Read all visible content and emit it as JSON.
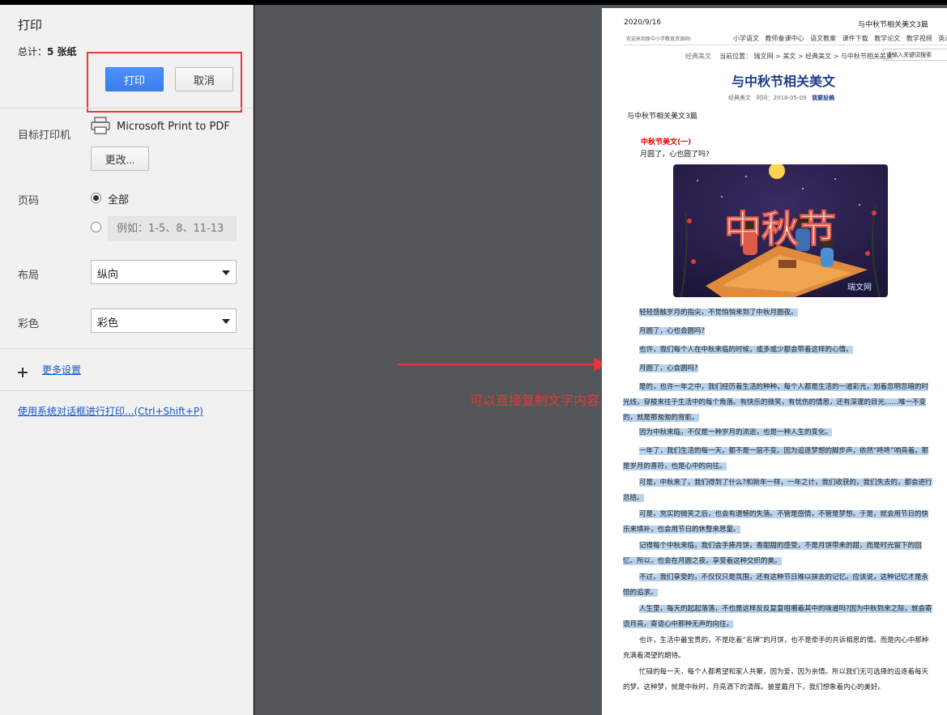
{
  "dialog": {
    "title": "打印",
    "summary_prefix": "总计：",
    "summary_count": "5 张纸",
    "print_label": "打印",
    "cancel_label": "取消",
    "destination_label": "目标打印机",
    "printer_name": "Microsoft Print to PDF",
    "change_label": "更改...",
    "pages_label": "页码",
    "pages_all_label": "全部",
    "pages_custom_placeholder": "例如：1-5、8、11-13",
    "layout_label": "布局",
    "layout_value": "纵向",
    "color_label": "彩色",
    "color_value": "彩色",
    "more_settings_label": "更多设置",
    "system_dialog_label": "使用系统对话框进行打印...(Ctrl+Shift+P)"
  },
  "annotation": {
    "text": "可以直接复制文字内容",
    "color": "#e53935"
  },
  "page": {
    "header_date": "2020/9/16",
    "header_title": "与中秋节相关美文3篇",
    "site_welcome": "欢迎来到原中小学教育资源网!",
    "site_nav": [
      "小学语文",
      "教师备课中心",
      "语文教案",
      "课件下载",
      "教学论文",
      "教学视频",
      "英语教学"
    ],
    "crumb_left": "经典美文",
    "crumb": "当前位置：  瑞文网 > 美文 > 经典美文 > 与中秋节相关美文",
    "search_placeholder": "请输入关键词搜索",
    "article_title": "与中秋节相关美文",
    "meta_category": "经典美文",
    "meta_time": "时间：2018-05-09",
    "meta_submit": "我要投稿",
    "sub_heading": "与中秋节相关美文3篇",
    "section_title": "中秋节美文(一)",
    "section_question": "月圆了，心也圆了吗?",
    "image_text": "中秋节",
    "image_watermark": "瑞文网",
    "paragraphs": [
      "轻轻感触岁月的指尖，不觉悄悄来到了中秋月圆夜。",
      "月圆了，心也会圆吗?",
      "也许，我们每个人在中秋来临的时候，或多或少都会带着这样的心情。",
      "月圆了，心会圆吗?",
      "是的，也许一年之中，我们经历着生活的种种，每个人都是生活的一道彩光，划着忽明忽暗的时光线，穿梭来往于生活中的每个角落。有快乐的微笑，有忧伤的情思，还有深邃的目光……唯一不变的，就是那匆匆的背影。",
      "因为中秋来临，不仅是一种岁月的流逝，也是一种人生的变化。",
      "一年了，我们生活的每一天，都不是一层不变。因为追逐梦想的脚步声，依然“咚咚”响亮着。那是岁月的喜符，也是心中的向往。",
      "可是，中秋来了，我们得到了什么?和新年一样，一年之计，我们收获的，我们失去的，都会进行总结。",
      "可是，充实的微笑之后，也会有遗憾的失落。不管是感情，不管是梦想。于是，就会用节日的快乐来填补，也会用节日的休整来思量。",
      "记得每个中秋来临，我们会手捧月饼，香甜甜的感受，不是月饼带来的甜，而是时光留下的回忆。所以，也会在月圆之夜，享受着这种交织的美。",
      "不过，我们享受的，不仅仅只是氛围，还有这种节日难以抹去的记忆。应该说，这种记忆才是永恒的追求。",
      "人生里，每天的起起落落，不也是这样反反复复咀嚼着其中的味道吗?因为中秋到来之际，就会寄语月亮，寄语心中那种无声的向往。",
      "也许，生活中最宝贵的，不是吃着“名牌”的月饼，也不是牵手的共诉相思的情。而是内心中那种充满着渴望的期待。",
      "忙碌的每一天，每个人都希望和家人共聚，因为爱，因为亲情。所以我们无可选择的追逐着每天的梦。这种梦，就是中秋时，月亮洒下的清辉。披星戴月下，我们想象着内心的美好。"
    ]
  }
}
